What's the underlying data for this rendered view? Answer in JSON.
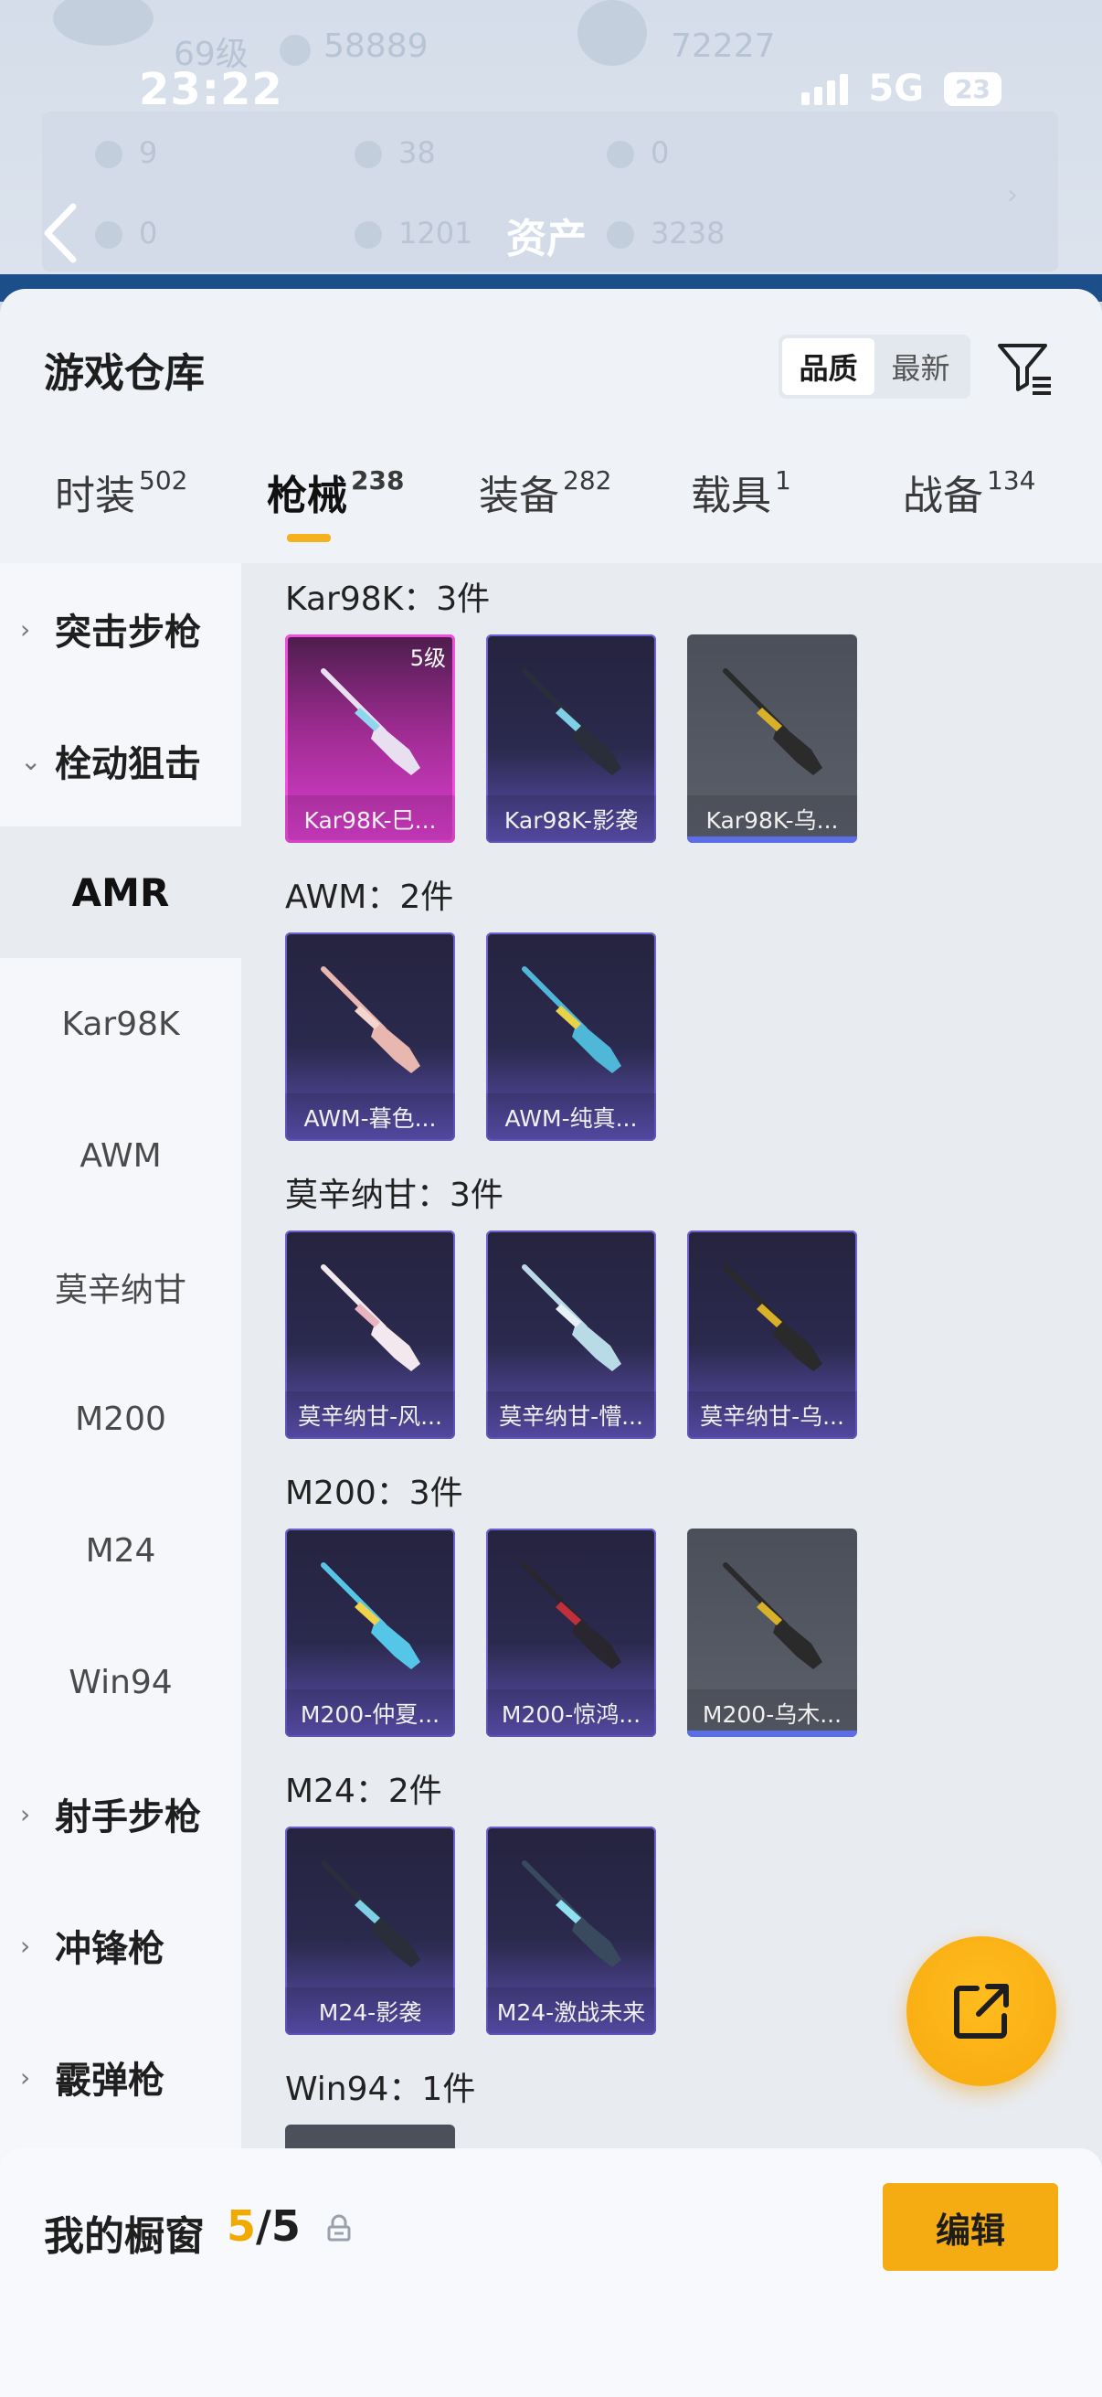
{
  "status_bar": {
    "time": "23:22",
    "network": "5G",
    "battery": "23"
  },
  "header": {
    "title": "资产",
    "faded_level": "69级",
    "faded_coins": "58889",
    "faded_other": "72227",
    "stats_row1": [
      "9",
      "38",
      "0"
    ],
    "stats_row2": [
      "0",
      "1201",
      "3238"
    ]
  },
  "warehouse": {
    "title": "游戏仓库",
    "sort_options": [
      "品质",
      "最新"
    ],
    "active_sort": "品质"
  },
  "tabs": [
    {
      "label": "时装",
      "count": "502"
    },
    {
      "label": "枪械",
      "count": "238",
      "active": true
    },
    {
      "label": "装备",
      "count": "282"
    },
    {
      "label": "载具",
      "count": "1"
    },
    {
      "label": "战备",
      "count": "134"
    }
  ],
  "side_nav": [
    {
      "label": "突击步枪",
      "kind": "category",
      "state": "collapsed"
    },
    {
      "label": "栓动狙击",
      "kind": "category",
      "state": "expanded"
    },
    {
      "label": "AMR",
      "kind": "sub",
      "selected": true
    },
    {
      "label": "Kar98K",
      "kind": "sub"
    },
    {
      "label": "AWM",
      "kind": "sub"
    },
    {
      "label": "莫辛纳甘",
      "kind": "sub"
    },
    {
      "label": "M200",
      "kind": "sub"
    },
    {
      "label": "M24",
      "kind": "sub"
    },
    {
      "label": "Win94",
      "kind": "sub"
    },
    {
      "label": "射手步枪",
      "kind": "category",
      "state": "collapsed"
    },
    {
      "label": "冲锋枪",
      "kind": "category",
      "state": "collapsed"
    },
    {
      "label": "霰弹枪",
      "kind": "category",
      "state": "collapsed"
    }
  ],
  "groups": [
    {
      "title": "Kar98K：3件",
      "items": [
        {
          "name": "Kar98K-巳...",
          "rarity": "pink",
          "level": "5级",
          "weapon_color": "#e8e0f0",
          "accent": "#8fd6f0"
        },
        {
          "name": "Kar98K-影袭",
          "rarity": "purple",
          "weapon_color": "#2a2d3a",
          "accent": "#7fd0e6"
        },
        {
          "name": "Kar98K-乌...",
          "rarity": "grey",
          "weapon_color": "#2b2b2b",
          "accent": "#d8b02a"
        }
      ]
    },
    {
      "title": "AWM：2件",
      "items": [
        {
          "name": "AWM-暮色...",
          "rarity": "purple",
          "weapon_color": "#e8b7b0",
          "accent": "#f4d6cf"
        },
        {
          "name": "AWM-纯真...",
          "rarity": "purple",
          "weapon_color": "#4fb7d8",
          "accent": "#e8d24a"
        }
      ]
    },
    {
      "title": "莫辛纳甘：3件",
      "items": [
        {
          "name": "莫辛纳甘-风...",
          "rarity": "purple",
          "weapon_color": "#f2e8ee",
          "accent": "#e8b4c0"
        },
        {
          "name": "莫辛纳甘-懵...",
          "rarity": "purple",
          "weapon_color": "#b9dbe8",
          "accent": "#e8f2f6"
        },
        {
          "name": "莫辛纳甘-乌...",
          "rarity": "purple",
          "weapon_color": "#2a2a2a",
          "accent": "#d8b02a"
        }
      ]
    },
    {
      "title": "M200：3件",
      "items": [
        {
          "name": "M200-仲夏...",
          "rarity": "purple",
          "weapon_color": "#56c6e8",
          "accent": "#f2d24a"
        },
        {
          "name": "M200-惊鸿...",
          "rarity": "purple",
          "weapon_color": "#2a2630",
          "accent": "#c0303a"
        },
        {
          "name": "M200-乌木...",
          "rarity": "grey",
          "weapon_color": "#2a2a2a",
          "accent": "#d8b02a"
        }
      ]
    },
    {
      "title": "M24：2件",
      "items": [
        {
          "name": "M24-影袭",
          "rarity": "purple",
          "weapon_color": "#2a2d3a",
          "accent": "#7fd0e6"
        },
        {
          "name": "M24-激战未来",
          "rarity": "purple",
          "weapon_color": "#3a4a5e",
          "accent": "#8fe0f0"
        }
      ]
    },
    {
      "title": "Win94：1件",
      "items": [
        {
          "name": "",
          "rarity": "grey",
          "weapon_color": "#2a2a2a",
          "accent": "#444444"
        }
      ]
    }
  ],
  "showcase": {
    "title": "我的橱窗",
    "current": "5",
    "total": "5",
    "edit_label": "编辑"
  },
  "colors": {
    "accent": "#f5ab12",
    "rare_pink": "#dd3fcf",
    "rare_purple": "#5f52b6"
  }
}
